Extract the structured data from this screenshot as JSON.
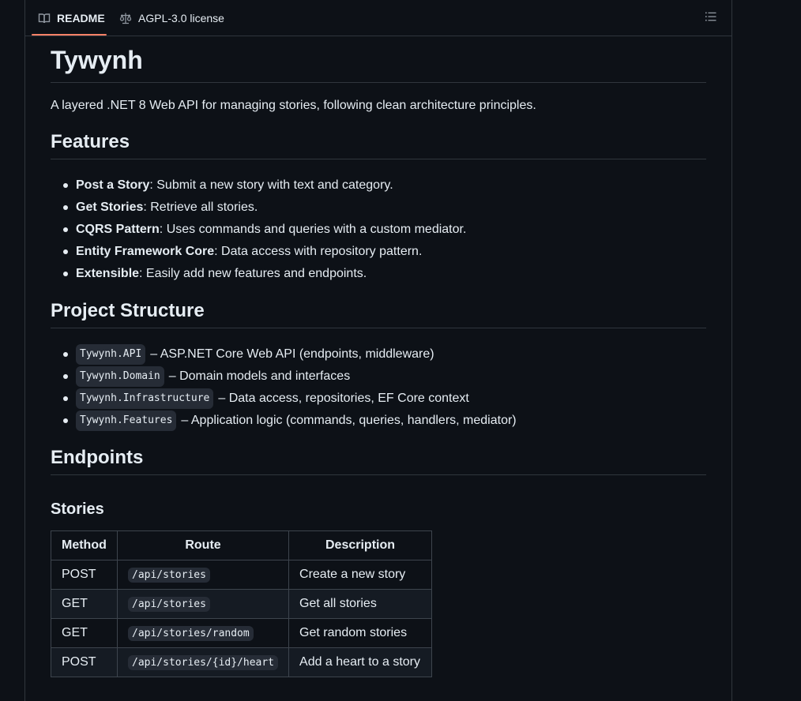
{
  "tabs": {
    "readme": "README",
    "license": "AGPL-3.0 license"
  },
  "title": "Tywynh",
  "intro": "A layered .NET 8 Web API for managing stories, following clean architecture principles.",
  "features": {
    "heading": "Features",
    "items": [
      {
        "name": "Post a Story",
        "desc": ": Submit a new story with text and category."
      },
      {
        "name": "Get Stories",
        "desc": ": Retrieve all stories."
      },
      {
        "name": "CQRS Pattern",
        "desc": ": Uses commands and queries with a custom mediator."
      },
      {
        "name": "Entity Framework Core",
        "desc": ": Data access with repository pattern."
      },
      {
        "name": "Extensible",
        "desc": ": Easily add new features and endpoints."
      }
    ]
  },
  "structure": {
    "heading": "Project Structure",
    "items": [
      {
        "code": "Tywynh.API",
        "desc": "– ASP.NET Core Web API (endpoints, middleware)"
      },
      {
        "code": "Tywynh.Domain",
        "desc": "– Domain models and interfaces"
      },
      {
        "code": "Tywynh.Infrastructure",
        "desc": "– Data access, repositories, EF Core context"
      },
      {
        "code": "Tywynh.Features",
        "desc": "– Application logic (commands, queries, handlers, mediator)"
      }
    ]
  },
  "endpoints": {
    "heading": "Endpoints",
    "subheading": "Stories",
    "columns": [
      "Method",
      "Route",
      "Description"
    ],
    "rows": [
      {
        "method": "POST",
        "route": "/api/stories",
        "desc": "Create a new story"
      },
      {
        "method": "GET",
        "route": "/api/stories",
        "desc": "Get all stories"
      },
      {
        "method": "GET",
        "route": "/api/stories/random",
        "desc": "Get random stories"
      },
      {
        "method": "POST",
        "route": "/api/stories/{id}/heart",
        "desc": "Add a heart to a story"
      }
    ]
  }
}
